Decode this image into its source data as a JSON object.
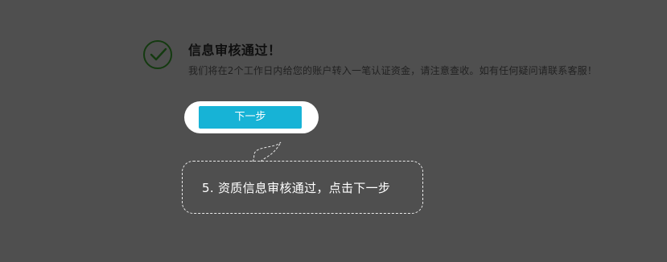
{
  "result": {
    "title": "信息审核通过！",
    "description": "我们将在2个工作日内给您的账户转入一笔认证资金，请注意查收。如有任何疑问请联系客服！",
    "icon": "check-circle-icon"
  },
  "actions": {
    "next_label": "下一步"
  },
  "tutorial": {
    "tip": "5. 资质信息审核通过，点击下一步"
  },
  "colors": {
    "overlay": "#4f4f4f",
    "button": "#17b3d6",
    "check": "#143a10"
  }
}
